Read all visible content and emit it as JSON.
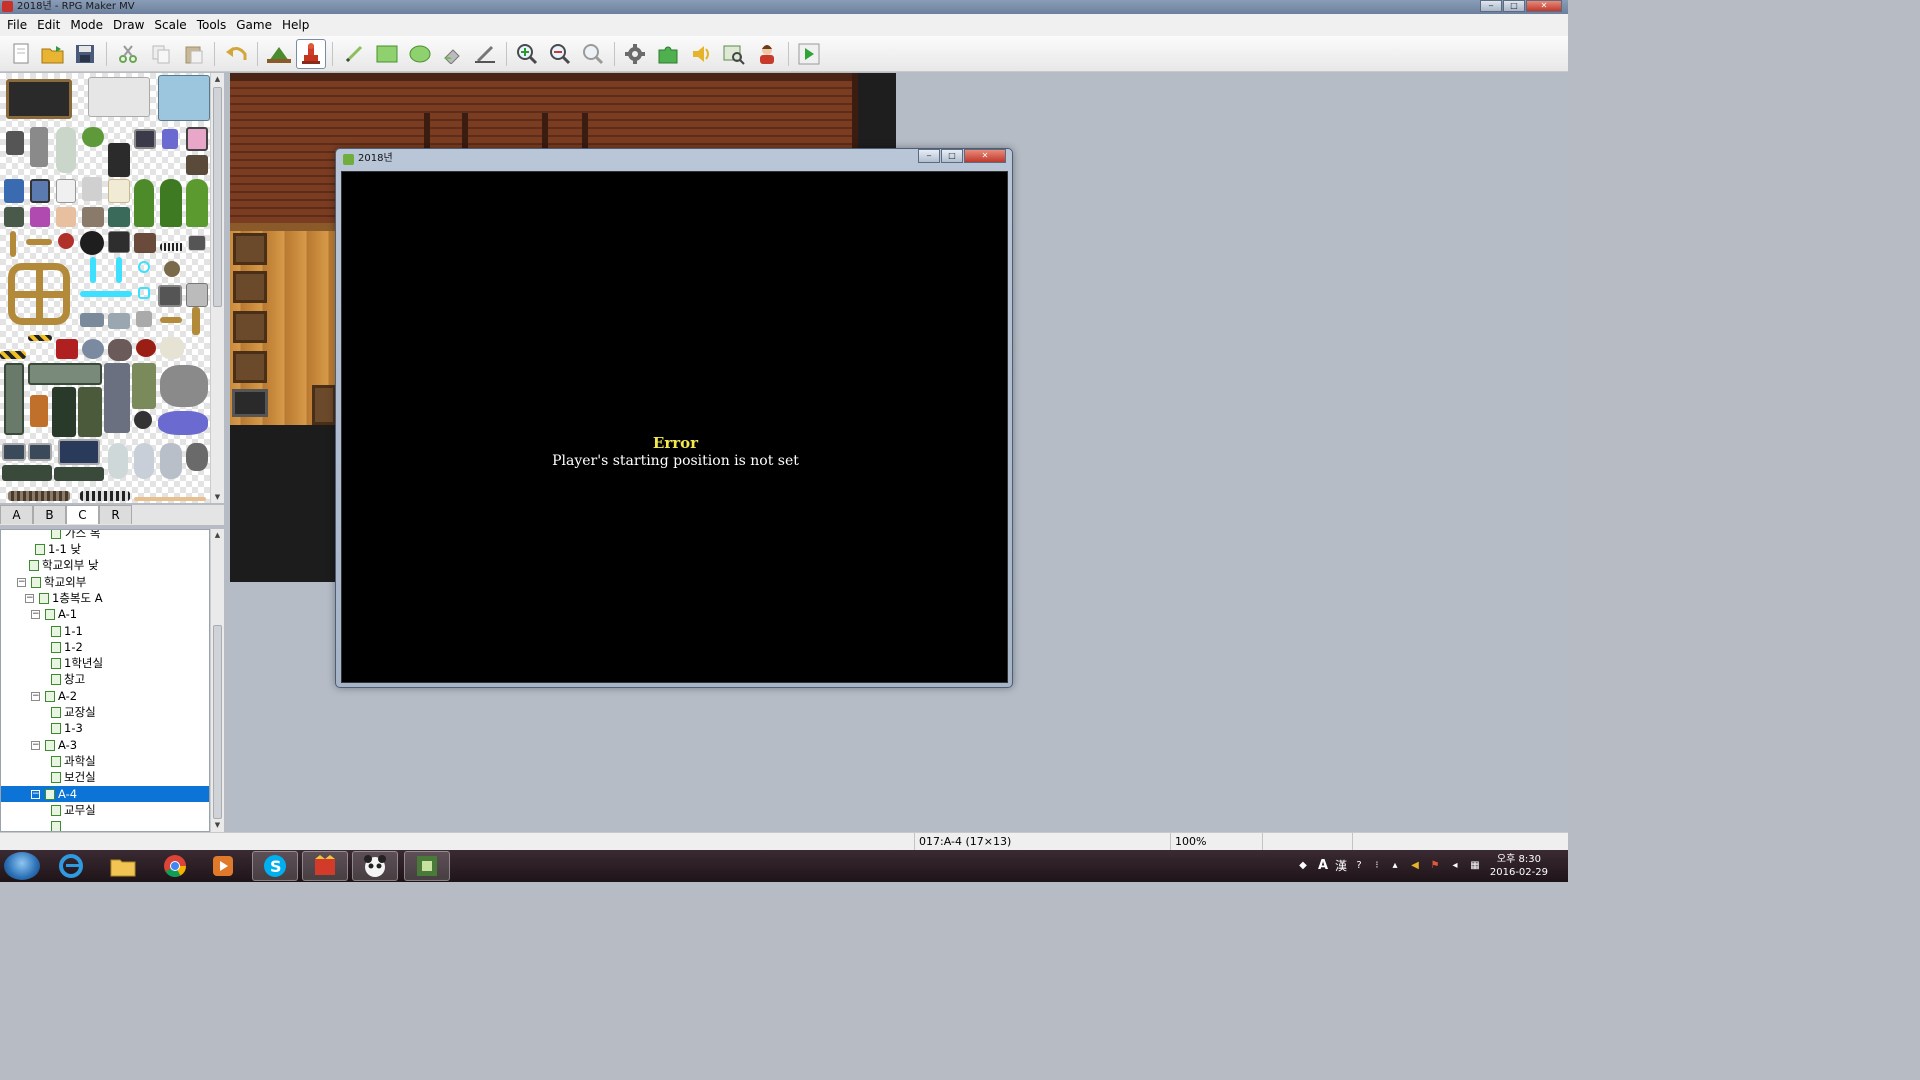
{
  "window": {
    "title": "2018년 - RPG Maker MV",
    "minimize": "‒",
    "maximize": "□",
    "close": "✕"
  },
  "menu": [
    "File",
    "Edit",
    "Mode",
    "Draw",
    "Scale",
    "Tools",
    "Game",
    "Help"
  ],
  "toolbar": {
    "buttons": [
      {
        "name": "new-project-icon"
      },
      {
        "name": "open-project-icon"
      },
      {
        "name": "save-project-icon"
      },
      {
        "name": "cut-icon"
      },
      {
        "name": "copy-icon"
      },
      {
        "name": "paste-icon"
      },
      {
        "name": "undo-icon"
      },
      {
        "name": "map-mode-icon"
      },
      {
        "name": "event-mode-icon",
        "active": true
      },
      {
        "name": "pencil-icon"
      },
      {
        "name": "rectangle-icon"
      },
      {
        "name": "ellipse-icon"
      },
      {
        "name": "fill-icon"
      },
      {
        "name": "shadow-pen-icon"
      },
      {
        "name": "zoom-in-icon"
      },
      {
        "name": "zoom-out-icon"
      },
      {
        "name": "actual-size-icon"
      },
      {
        "name": "database-icon"
      },
      {
        "name": "plugin-manager-icon"
      },
      {
        "name": "sound-test-icon"
      },
      {
        "name": "event-searcher-icon"
      },
      {
        "name": "character-generator-icon"
      },
      {
        "name": "playtest-icon"
      }
    ]
  },
  "tileset_tabs": [
    "A",
    "B",
    "C",
    "R"
  ],
  "tileset_active_tab": "C",
  "map_tree": [
    {
      "label": "1-1 낮",
      "level": 3,
      "expander": ""
    },
    {
      "label": "학교외부 낮",
      "level": 2,
      "expander": ""
    },
    {
      "label": "학교외부",
      "level": 1,
      "expander": "⊟"
    },
    {
      "label": "1층복도 A",
      "level": 2,
      "expander": "⊟"
    },
    {
      "label": "A-1",
      "level": 3,
      "expander": "⊟"
    },
    {
      "label": "1-1",
      "level": 4,
      "expander": ""
    },
    {
      "label": "1-2",
      "level": 4,
      "expander": ""
    },
    {
      "label": "1학년실",
      "level": 4,
      "expander": ""
    },
    {
      "label": "창고",
      "level": 4,
      "expander": ""
    },
    {
      "label": "A-2",
      "level": 3,
      "expander": "⊟"
    },
    {
      "label": "교장실",
      "level": 4,
      "expander": ""
    },
    {
      "label": "1-3",
      "level": 4,
      "expander": ""
    },
    {
      "label": "A-3",
      "level": 3,
      "expander": "⊟"
    },
    {
      "label": "과학실",
      "level": 4,
      "expander": ""
    },
    {
      "label": "보건실",
      "level": 4,
      "expander": ""
    },
    {
      "label": "A-4",
      "level": 3,
      "expander": "⊟",
      "selected": true
    },
    {
      "label": "교무실",
      "level": 4,
      "expander": ""
    },
    {
      "label": "",
      "level": 4,
      "expander": ""
    }
  ],
  "game_window": {
    "title": "2018년",
    "error_title": "Error",
    "error_message": "Player's starting position is not set",
    "buttons": {
      "minimize": "‒",
      "maximize": "□",
      "close": "✕"
    }
  },
  "statusbar": {
    "map_info": "017:A-4 (17×13)",
    "zoom": "100%"
  },
  "taskbar": {
    "apps": [
      "internet-explorer-icon",
      "file-explorer-icon",
      "chrome-icon",
      "media-player-icon",
      "skype-icon",
      "rpg-maker-icon",
      "panda-app-icon",
      "game-window-icon"
    ],
    "clock_period": "오후 8:30",
    "clock_date": "2016-02-29",
    "ime": "A",
    "ime2": "漢"
  },
  "colors": {
    "selection": "#0b74d6",
    "error_title": "#f2e94e",
    "map_background": "#b5bcc6"
  }
}
